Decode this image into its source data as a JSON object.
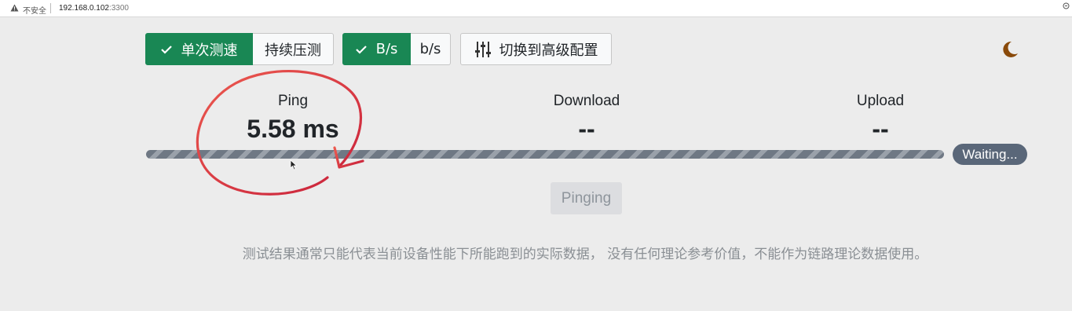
{
  "browser": {
    "security_label": "不安全",
    "url_host": "192.168.0.102",
    "url_port": ":3300"
  },
  "toolbar": {
    "mode_single": "单次测速",
    "mode_continuous": "持续压测",
    "unit_bytes": "B/s",
    "unit_bits": "b/s",
    "advanced": "切换到高级配置",
    "active_mode": "single",
    "active_unit": "B/s"
  },
  "stats": {
    "ping": {
      "label": "Ping",
      "value": "5.58 ms"
    },
    "download": {
      "label": "Download",
      "value": "--"
    },
    "upload": {
      "label": "Upload",
      "value": "--"
    }
  },
  "progress": {
    "status": "Waiting..."
  },
  "action": {
    "label": "Pinging"
  },
  "disclaimer": "测试结果通常只能代表当前设备性能下所能跑到的实际数据， 没有任何理论参考价值，不能作为链路理论数据使用。",
  "colors": {
    "accent": "#198754",
    "badge": "#5a6779",
    "annotation": "#e0393e",
    "moon": "#8a4a0a"
  }
}
